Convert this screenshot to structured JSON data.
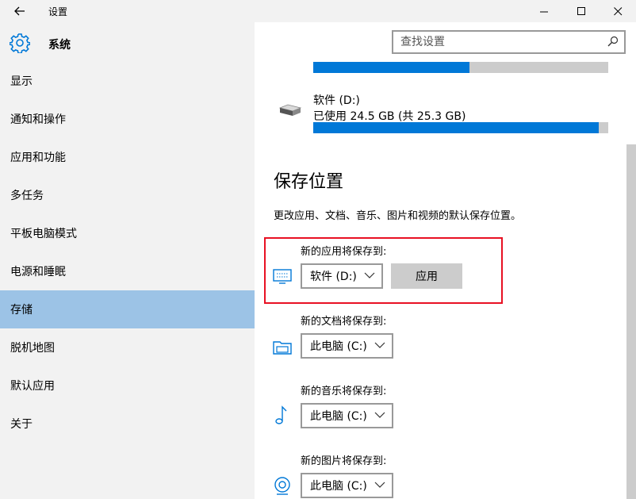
{
  "window": {
    "title": "设置",
    "back_icon": "back-arrow-icon",
    "min_glyph": "—",
    "max_glyph": "☐",
    "close_glyph": "✕"
  },
  "header": {
    "title": "系统",
    "icon": "gear-icon"
  },
  "search": {
    "placeholder": "查找设置"
  },
  "sidebar": {
    "items": [
      {
        "label": "显示"
      },
      {
        "label": "通知和操作"
      },
      {
        "label": "应用和功能"
      },
      {
        "label": "多任务"
      },
      {
        "label": "平板电脑模式"
      },
      {
        "label": "电源和睡眠"
      },
      {
        "label": "存储",
        "active": true
      },
      {
        "label": "脱机地图"
      },
      {
        "label": "默认应用"
      },
      {
        "label": "关于"
      }
    ]
  },
  "storage": {
    "drives": [
      {
        "usage_fraction": 0.53
      },
      {
        "name": "软件 (D:)",
        "usage": "已使用 24.5 GB (共 25.3 GB)",
        "usage_fraction": 0.968
      }
    ]
  },
  "save_locations": {
    "title": "保存位置",
    "description": "更改应用、文档、音乐、图片和视频的默认保存位置。",
    "apply_label": "应用",
    "items": [
      {
        "label": "新的应用将保存到:",
        "value": "软件 (D:)",
        "icon": "app-monitor-icon"
      },
      {
        "label": "新的文档将保存到:",
        "value": "此电脑 (C:)",
        "icon": "folder-icon"
      },
      {
        "label": "新的音乐将保存到:",
        "value": "此电脑 (C:)",
        "icon": "music-note-icon"
      },
      {
        "label": "新的图片将保存到:",
        "value": "此电脑 (C:)",
        "icon": "camera-icon"
      }
    ]
  },
  "colors": {
    "accent": "#0078d7",
    "sidebar_active": "#9cc3e6",
    "highlight_border": "#e81123"
  }
}
